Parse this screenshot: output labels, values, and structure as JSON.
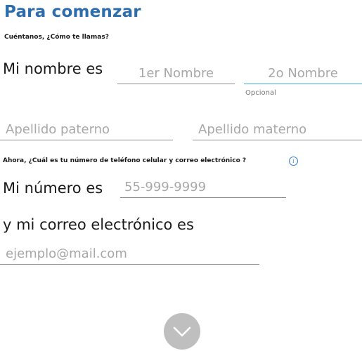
{
  "header": {
    "title": "Para comenzar",
    "name_prompt": "Cuéntanos, ¿Cómo te llamas?"
  },
  "name_section": {
    "lead": "Mi nombre es",
    "first_name_placeholder": "1er Nombre",
    "second_name_placeholder": "2o Nombre",
    "second_name_helper": "Opcional",
    "paternal_placeholder": "Apellido paterno",
    "maternal_placeholder": "Apellido materno"
  },
  "contact_section": {
    "prompt": "Ahora, ¿Cuál es tu número de teléfono celular y correo electrónico ?",
    "info_icon": "info-icon",
    "phone_lead": "Mi número es",
    "phone_placeholder": "55-999-9999",
    "email_lead": "y mi correo electrónico es",
    "email_placeholder": "ejemplo@mail.com"
  },
  "navigation": {
    "next_icon": "chevron-down-icon"
  },
  "colors": {
    "title": "#2d6dab",
    "active_underline": "#3ba6d8",
    "info_icon": "#2f7fd0",
    "next_button": "#bfbfbf"
  }
}
